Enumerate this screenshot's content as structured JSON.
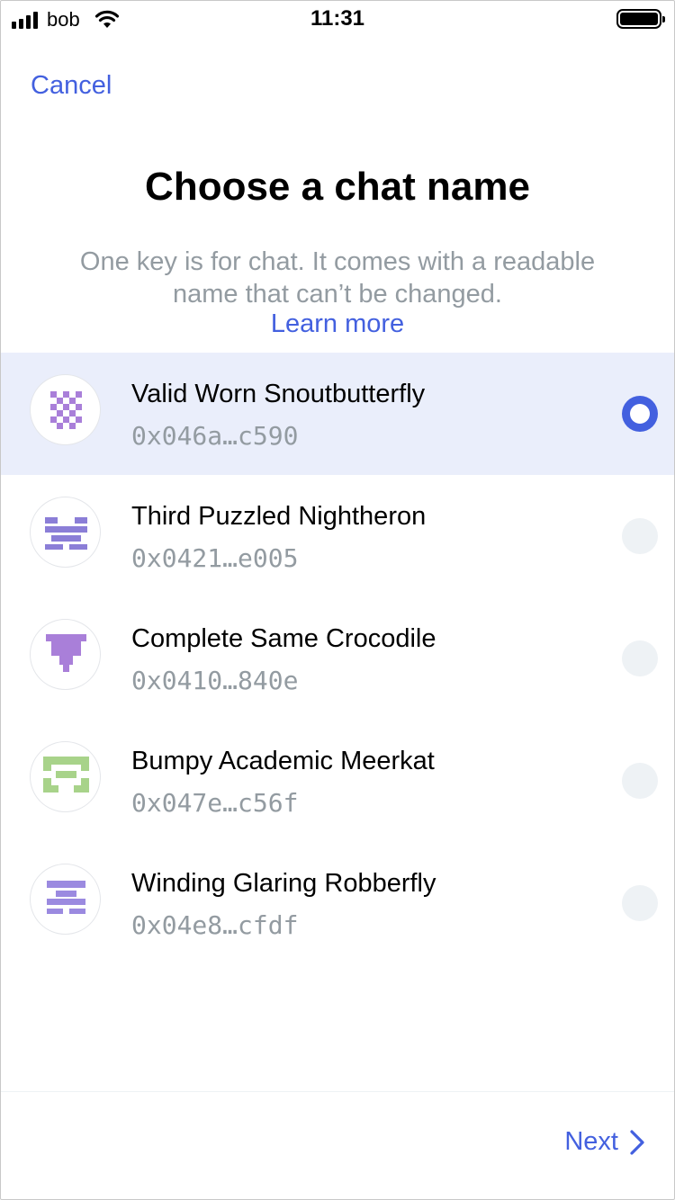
{
  "status_bar": {
    "carrier": "bob",
    "time": "11:31",
    "battery_level": 1.0
  },
  "header": {
    "cancel_label": "Cancel"
  },
  "main": {
    "title": "Choose a chat name",
    "subtitle": "One key is for chat. It comes with a readable name that can’t be changed.",
    "learn_more": "Learn more"
  },
  "accounts": [
    {
      "name": "Valid Worn Snoutbutterfly",
      "key": "0x046a…c590",
      "selected": true,
      "avatar_color": "#a97fd9",
      "avatar_icon": "identicon-checker"
    },
    {
      "name": "Third Puzzled Nightheron",
      "key": "0x0421…e005",
      "selected": false,
      "avatar_color": "#8b7ed7",
      "avatar_icon": "identicon-bars"
    },
    {
      "name": "Complete Same Crocodile",
      "key": "0x0410…840e",
      "selected": false,
      "avatar_color": "#a97fd9",
      "avatar_icon": "identicon-tee"
    },
    {
      "name": "Bumpy Academic Meerkat",
      "key": "0x047e…c56f",
      "selected": false,
      "avatar_color": "#a8d38a",
      "avatar_icon": "identicon-frame"
    },
    {
      "name": "Winding Glaring Robberfly",
      "key": "0x04e8…cfdf",
      "selected": false,
      "avatar_color": "#9b8ae0",
      "avatar_icon": "identicon-stack"
    }
  ],
  "footer": {
    "next_label": "Next"
  },
  "colors": {
    "accent": "#4360df",
    "muted": "#939ba1",
    "selected_row": "#eaeefb",
    "radio_off": "#eef2f5"
  }
}
